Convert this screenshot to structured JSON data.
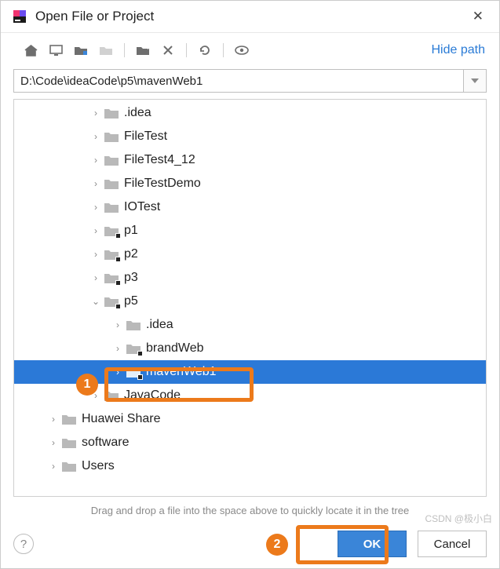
{
  "title": "Open File or Project",
  "path_value": "D:\\Code\\ideaCode\\p5\\mavenWeb1",
  "hide_path_label": "Hide path",
  "hint": "Drag and drop a file into the space above to quickly locate it in the tree",
  "buttons": {
    "ok": "OK",
    "cancel": "Cancel"
  },
  "annotations": {
    "marker1": "1",
    "marker2": "2"
  },
  "watermark": "CSDN @极小白",
  "toolbar_icons": [
    "home",
    "desktop",
    "new-folder",
    "new-folder-disabled",
    "new-module",
    "delete",
    "refresh",
    "show-hidden"
  ],
  "tree": [
    {
      "indent": 96,
      "chev": ">",
      "icon": "folder",
      "label": ".idea"
    },
    {
      "indent": 96,
      "chev": ">",
      "icon": "folder",
      "label": "FileTest"
    },
    {
      "indent": 96,
      "chev": ">",
      "icon": "folder",
      "label": "FileTest4_12"
    },
    {
      "indent": 96,
      "chev": ">",
      "icon": "folder",
      "label": "FileTestDemo"
    },
    {
      "indent": 96,
      "chev": ">",
      "icon": "folder",
      "label": "IOTest"
    },
    {
      "indent": 96,
      "chev": ">",
      "icon": "folder-mod",
      "label": "p1"
    },
    {
      "indent": 96,
      "chev": ">",
      "icon": "folder-mod",
      "label": "p2"
    },
    {
      "indent": 96,
      "chev": ">",
      "icon": "folder-mod",
      "label": "p3"
    },
    {
      "indent": 96,
      "chev": "v",
      "icon": "folder-mod",
      "label": "p5"
    },
    {
      "indent": 124,
      "chev": ">",
      "icon": "folder",
      "label": ".idea"
    },
    {
      "indent": 124,
      "chev": ">",
      "icon": "folder-mod",
      "label": "brandWeb"
    },
    {
      "indent": 124,
      "chev": ">",
      "icon": "folder-mod",
      "label": "mavenWeb1",
      "selected": true
    },
    {
      "indent": 96,
      "chev": ">",
      "icon": "folder",
      "label": "JavaCode"
    },
    {
      "indent": 42,
      "chev": ">",
      "icon": "folder",
      "label": "Huawei Share"
    },
    {
      "indent": 42,
      "chev": ">",
      "icon": "folder",
      "label": "software"
    },
    {
      "indent": 42,
      "chev": ">",
      "icon": "folder",
      "label": "Users"
    }
  ]
}
